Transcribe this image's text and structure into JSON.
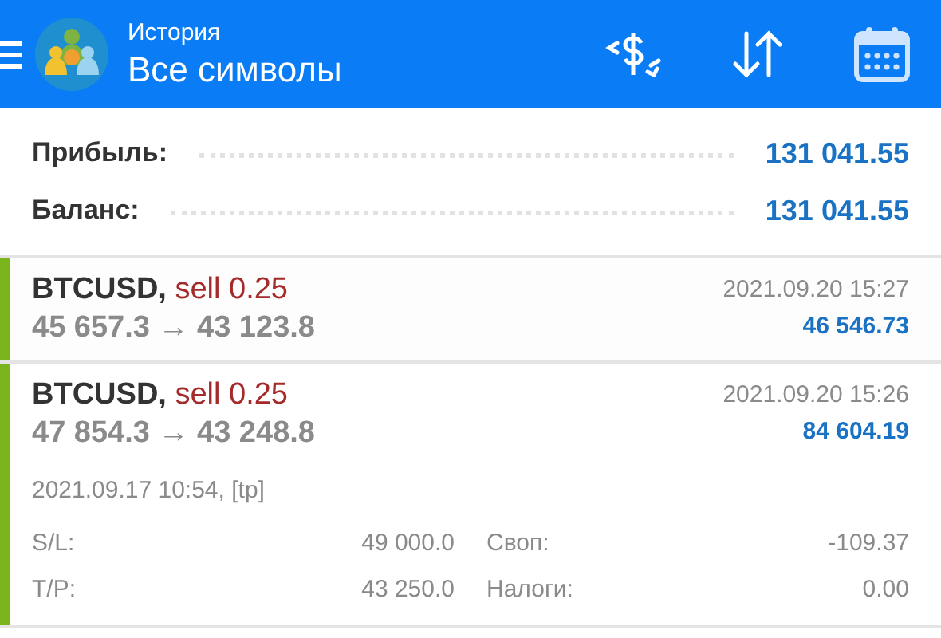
{
  "app_bar": {
    "subtitle": "История",
    "title": "Все символы"
  },
  "summary": [
    {
      "label": "Прибыль:",
      "value": "131 041.55"
    },
    {
      "label": "Баланс:",
      "value": "131 041.55"
    }
  ],
  "deals": [
    {
      "symbol": "BTCUSD,",
      "action": "sell 0.25",
      "prices": "45 657.3 → 43 123.8",
      "time": "2021.09.20 15:27",
      "profit": "46 546.73",
      "expanded": false
    },
    {
      "symbol": "BTCUSD,",
      "action": "sell 0.25",
      "prices": "47 854.3 → 43 248.8",
      "time": "2021.09.20 15:26",
      "profit": "84 604.19",
      "expanded": true,
      "opened": "2021.09.17 10:54, [tp]",
      "fields": [
        {
          "label": "S/L:",
          "value": "49 000.0"
        },
        {
          "label": "Своп:",
          "value": "-109.37"
        },
        {
          "label": "T/P:",
          "value": "43 250.0"
        },
        {
          "label": "Налоги:",
          "value": "0.00"
        }
      ]
    }
  ]
}
